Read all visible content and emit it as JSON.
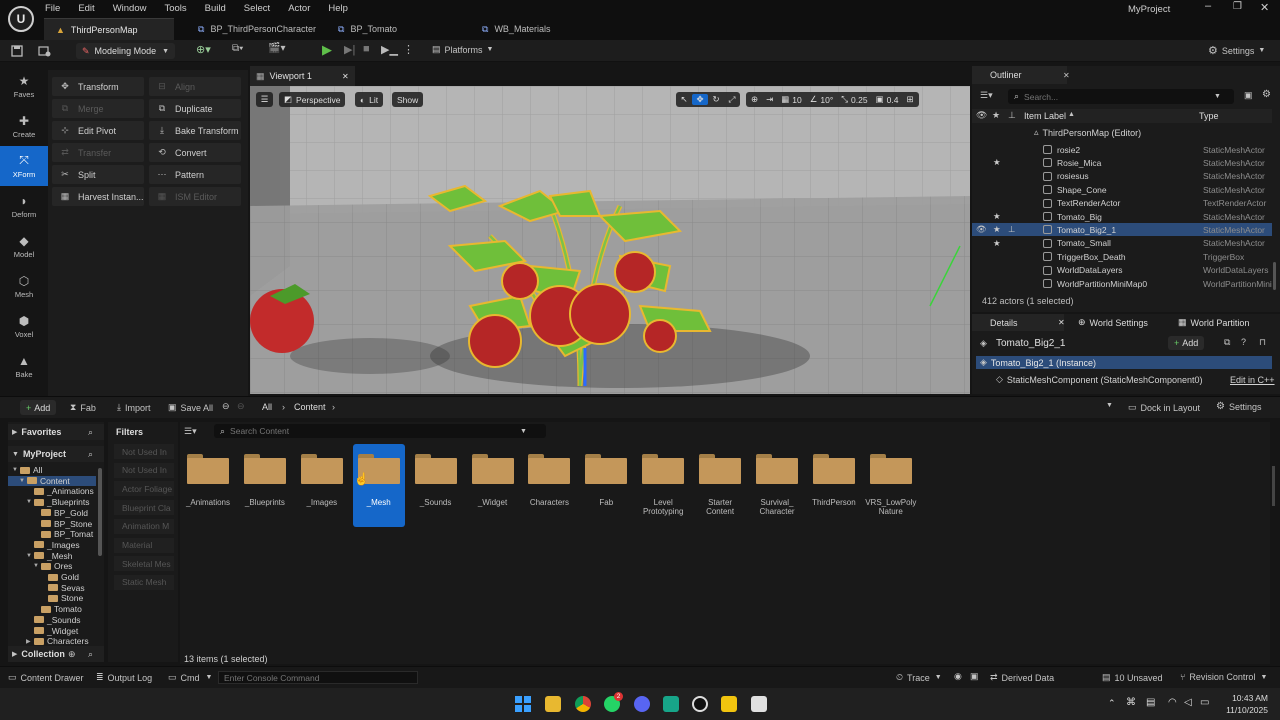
{
  "menu": [
    "File",
    "Edit",
    "Window",
    "Tools",
    "Build",
    "Select",
    "Actor",
    "Help"
  ],
  "project_name": "MyProject",
  "tabs": [
    {
      "label": "ThirdPersonMap",
      "active": true
    },
    {
      "label": "BP_ThirdPersonCharacter",
      "active": false
    },
    {
      "label": "BP_Tomato",
      "active": false
    },
    {
      "label": "WB_Materials",
      "active": false
    }
  ],
  "toolbar": {
    "mode_label": "Modeling Mode",
    "platforms_label": "Platforms",
    "settings_label": "Settings"
  },
  "modes": [
    {
      "label": "Faves",
      "icon": "star-icon",
      "active": false
    },
    {
      "label": "Create",
      "icon": "create-icon",
      "active": false
    },
    {
      "label": "XForm",
      "icon": "xform-icon",
      "active": true
    },
    {
      "label": "Deform",
      "icon": "deform-icon",
      "active": false
    },
    {
      "label": "Model",
      "icon": "model-icon",
      "active": false
    },
    {
      "label": "Mesh",
      "icon": "mesh-icon",
      "active": false
    },
    {
      "label": "Voxel",
      "icon": "voxel-icon",
      "active": false
    },
    {
      "label": "Bake",
      "icon": "bake-icon",
      "active": false
    }
  ],
  "tools_left": [
    {
      "label": "Transform",
      "enabled": true
    },
    {
      "label": "Merge",
      "enabled": false
    },
    {
      "label": "Edit Pivot",
      "enabled": true
    },
    {
      "label": "Transfer",
      "enabled": false
    },
    {
      "label": "Split",
      "enabled": true
    },
    {
      "label": "Harvest Instan...",
      "enabled": true
    }
  ],
  "tools_right": [
    {
      "label": "Align",
      "enabled": false
    },
    {
      "label": "Duplicate",
      "enabled": true
    },
    {
      "label": "Bake Transform",
      "enabled": true
    },
    {
      "label": "Convert",
      "enabled": true
    },
    {
      "label": "Pattern",
      "enabled": true
    },
    {
      "label": "ISM Editor",
      "enabled": false
    }
  ],
  "viewport": {
    "tab_label": "Viewport 1",
    "perspective": "Perspective",
    "lit": "Lit",
    "show": "Show",
    "grid_snap": "10",
    "rot_snap": "10°",
    "scale_snap": "0.25",
    "cam_speed": "0.4"
  },
  "outliner": {
    "title": "Outliner",
    "search_placeholder": "Search...",
    "col_label": "Item Label",
    "col_type": "Type",
    "root": "ThirdPersonMap (Editor)",
    "rows": [
      {
        "label": "rosie2",
        "type": "StaticMeshActor",
        "star": false,
        "selected": false
      },
      {
        "label": "Rosie_Mica",
        "type": "StaticMeshActor",
        "star": true,
        "selected": false
      },
      {
        "label": "rosiesus",
        "type": "StaticMeshActor",
        "star": false,
        "selected": false
      },
      {
        "label": "Shape_Cone",
        "type": "StaticMeshActor",
        "star": false,
        "selected": false
      },
      {
        "label": "TextRenderActor",
        "type": "TextRenderActor",
        "star": false,
        "selected": false
      },
      {
        "label": "Tomato_Big",
        "type": "StaticMeshActor",
        "star": true,
        "selected": false
      },
      {
        "label": "Tomato_Big2_1",
        "type": "StaticMeshActor",
        "star": true,
        "selected": true
      },
      {
        "label": "Tomato_Small",
        "type": "StaticMeshActor",
        "star": true,
        "selected": false
      },
      {
        "label": "TriggerBox_Death",
        "type": "TriggerBox",
        "star": false,
        "selected": false
      },
      {
        "label": "WorldDataLayers",
        "type": "WorldDataLayers",
        "star": false,
        "selected": false
      },
      {
        "label": "WorldPartitionMiniMap0",
        "type": "WorldPartitionMini",
        "star": false,
        "selected": false
      }
    ],
    "count": "412 actors (1 selected)"
  },
  "details": {
    "tabs": [
      "Details",
      "World Settings",
      "World Partition"
    ],
    "object_name": "Tomato_Big2_1",
    "add_label": "Add",
    "instance": "Tomato_Big2_1 (Instance)",
    "component": "StaticMeshComponent (StaticMeshComponent0)",
    "edit_cpp": "Edit in C++"
  },
  "content_browser": {
    "add": "Add",
    "fab": "Fab",
    "import": "Import",
    "save_all": "Save All",
    "path": [
      "All",
      "Content"
    ],
    "dock": "Dock in Layout",
    "settings": "Settings",
    "favorites": "Favorites",
    "project": "MyProject",
    "filters": "Filters",
    "search_placeholder": "Search Content",
    "tree": [
      "All",
      "Content",
      "_Animations",
      "_Blueprints",
      "BP_Gold",
      "BP_Stone",
      "BP_Tomat",
      "_Images",
      "_Mesh",
      "Ores",
      "Gold",
      "Sevas",
      "Stone",
      "Tomato",
      "_Sounds",
      "_Widget",
      "Characters"
    ],
    "filter_items": [
      "Not Used In",
      "Not Used In",
      "Actor Foliage",
      "Blueprint Cla",
      "Animation M",
      "Material",
      "Skeletal Mes",
      "Static Mesh"
    ],
    "folders": [
      {
        "name": "_Animations",
        "selected": false
      },
      {
        "name": "_Blueprints",
        "selected": false
      },
      {
        "name": "_Images",
        "selected": false
      },
      {
        "name": "_Mesh",
        "selected": true
      },
      {
        "name": "_Sounds",
        "selected": false
      },
      {
        "name": "_Widget",
        "selected": false
      },
      {
        "name": "Characters",
        "selected": false
      },
      {
        "name": "Fab",
        "selected": false
      },
      {
        "name": "Level Prototyping",
        "selected": false
      },
      {
        "name": "Starter Content",
        "selected": false
      },
      {
        "name": "Survival_ Character",
        "selected": false
      },
      {
        "name": "ThirdPerson",
        "selected": false
      },
      {
        "name": "VRS_LowPoly Nature",
        "selected": false
      }
    ],
    "items_count": "13 items (1 selected)",
    "collection": "Collection"
  },
  "statusbar": {
    "content_drawer": "Content Drawer",
    "output_log": "Output Log",
    "cmd": "Cmd",
    "console_placeholder": "Enter Console Command",
    "trace": "Trace",
    "derived_data": "Derived Data",
    "unsaved": "10 Unsaved",
    "revision": "Revision Control"
  },
  "taskbar": {
    "time": "10:43 AM",
    "date": "11/10/2025",
    "whatsapp_badge": "2"
  },
  "colors": {
    "accent": "#1567c9",
    "folder": "#c4975a",
    "selection": "#2c4c7a"
  }
}
